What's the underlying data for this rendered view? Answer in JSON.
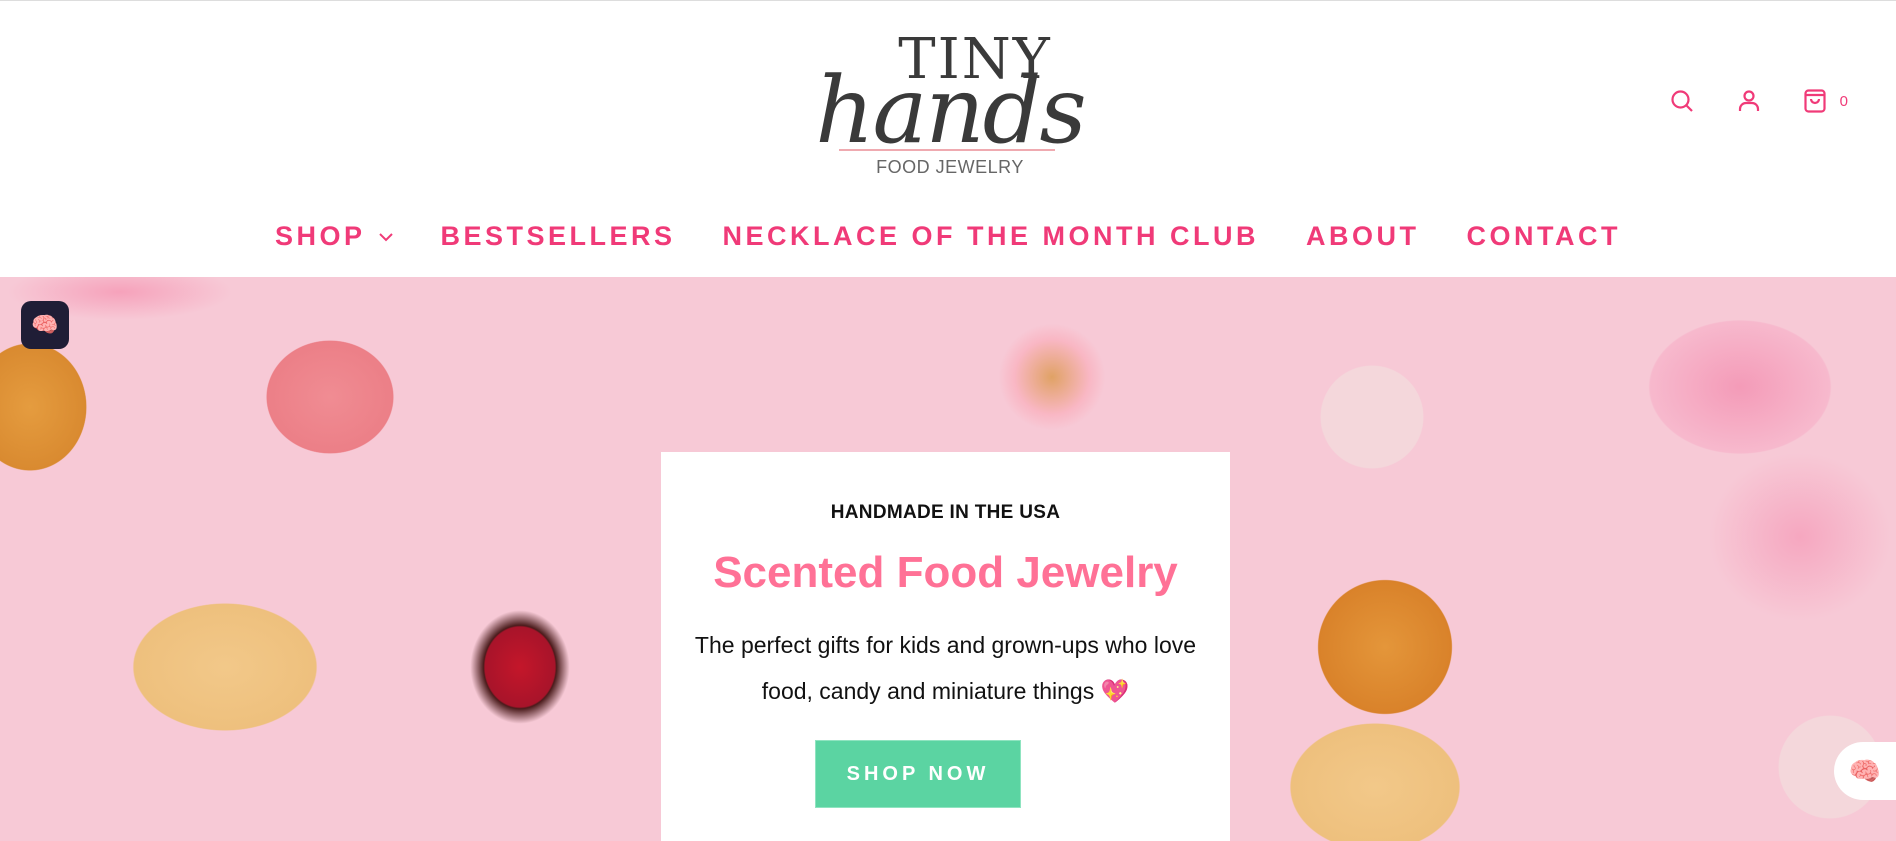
{
  "logo": {
    "line1": "TINY",
    "line2": "hands",
    "tagline": "FOOD JEWELRY"
  },
  "header": {
    "cart_count": "0"
  },
  "nav": {
    "items": [
      {
        "label": "SHOP"
      },
      {
        "label": "BESTSELLERS"
      },
      {
        "label": "NECKLACE OF THE MONTH CLUB"
      },
      {
        "label": "ABOUT"
      },
      {
        "label": "CONTACT"
      }
    ]
  },
  "hero": {
    "eyebrow": "HANDMADE IN THE USA",
    "title": "Scented Food Jewelry",
    "description": "The perfect gifts for kids and grown-ups who love food, candy and miniature things",
    "emoji": "💖",
    "cta_label": "SHOP NOW"
  },
  "widgets": {
    "left_icon": "brain-icon",
    "right_icon": "brain-icon"
  },
  "colors": {
    "accent": "#f03a78",
    "title": "#ff7196",
    "cta": "#5bd4a2"
  }
}
